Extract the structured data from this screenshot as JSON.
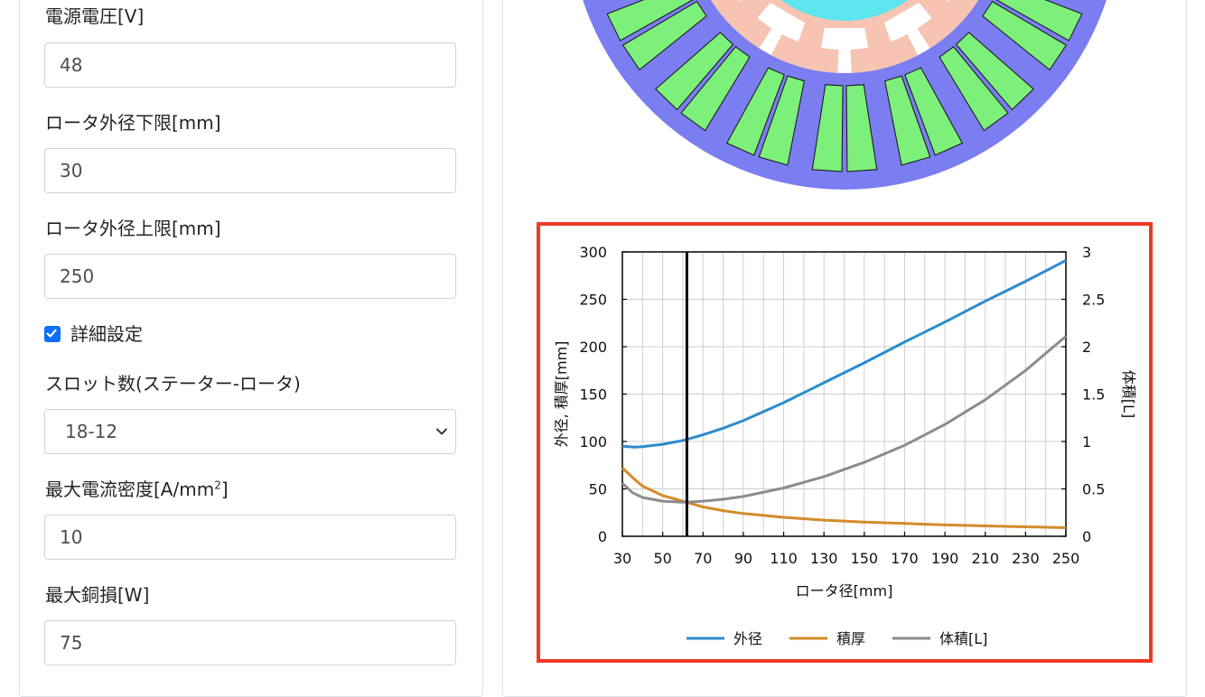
{
  "form": {
    "supply_voltage": {
      "label": "電源電圧[V]",
      "value": "48"
    },
    "rotor_od_min": {
      "label": "ロータ外径下限[mm]",
      "value": "30"
    },
    "rotor_od_max": {
      "label": "ロータ外径上限[mm]",
      "value": "250"
    },
    "advanced": {
      "label": "詳細設定",
      "checked": true
    },
    "slot_count": {
      "label": "スロット数(ステーター-ロータ)",
      "selected": "18-12"
    },
    "max_current_density": {
      "label_main": "最大電流密度[A/mm",
      "label_sup": "2",
      "label_end": "]",
      "value": "10"
    },
    "max_copper_loss": {
      "label": "最大銅損[W]",
      "value": "75"
    }
  },
  "colors": {
    "stator_core": "#7b7ef0",
    "coil": "#7df07b",
    "rotor_core": "#f7c4b3",
    "air_gap": "#ffffff",
    "shaft": "#5ee6ee",
    "highlight_border": "#ee3a23",
    "checkbox": "#0d6efd"
  },
  "icons": {
    "select_caret": "chevron-down-icon",
    "checkbox_mark": "check-icon"
  },
  "chart_data": {
    "type": "line",
    "xlabel": "ロータ径[mm]",
    "ylabel": "外径, 積厚[mm]",
    "y2label": "体積[L]",
    "xlim": [
      30,
      250
    ],
    "ylim": [
      0,
      300
    ],
    "y2lim": [
      0,
      3
    ],
    "x_ticks": [
      30,
      50,
      70,
      90,
      110,
      130,
      150,
      170,
      190,
      210,
      230,
      250
    ],
    "y_ticks": [
      0,
      50,
      100,
      150,
      200,
      250,
      300
    ],
    "y2_ticks": [
      "0",
      "0.5",
      "1",
      "1.5",
      "2",
      "2.5",
      "3"
    ],
    "grid": true,
    "legend": "bottom",
    "marker_x": 62,
    "series": [
      {
        "name": "外径",
        "axis": "left",
        "color": "#2e8bcb",
        "x": [
          30,
          36,
          40,
          50,
          60,
          70,
          80,
          90,
          110,
          130,
          150,
          170,
          190,
          210,
          230,
          250
        ],
        "y": [
          95,
          94,
          94.5,
          97,
          101,
          107,
          114,
          122,
          141,
          162,
          183,
          205,
          226,
          248,
          269,
          291
        ]
      },
      {
        "name": "積厚",
        "axis": "left",
        "color": "#d38b2a",
        "x": [
          30,
          35,
          40,
          50,
          60,
          70,
          80,
          90,
          110,
          130,
          150,
          170,
          190,
          210,
          230,
          250
        ],
        "y": [
          72,
          62,
          53,
          43,
          37,
          31,
          27,
          24,
          20,
          17,
          15,
          13.5,
          12,
          11,
          10,
          9
        ]
      },
      {
        "name": "体積[L]",
        "axis": "right",
        "color": "#8c8c8c",
        "x": [
          30,
          35,
          40,
          50,
          60,
          62,
          70,
          80,
          90,
          110,
          130,
          150,
          170,
          190,
          210,
          230,
          250
        ],
        "y": [
          0.56,
          0.46,
          0.41,
          0.37,
          0.36,
          0.36,
          0.37,
          0.39,
          0.42,
          0.51,
          0.63,
          0.78,
          0.96,
          1.18,
          1.44,
          1.75,
          2.11
        ]
      }
    ]
  }
}
